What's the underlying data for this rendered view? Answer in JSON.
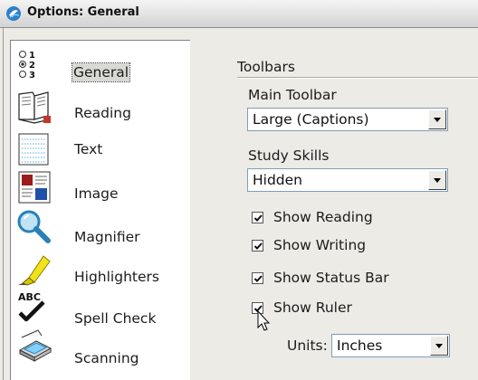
{
  "window": {
    "title": "Options: General"
  },
  "sidebar": {
    "items": [
      {
        "label": "General",
        "icon": "radio-list-icon",
        "selected": true
      },
      {
        "label": "Reading",
        "icon": "book-icon"
      },
      {
        "label": "Text",
        "icon": "text-page-icon"
      },
      {
        "label": "Image",
        "icon": "picture-icon"
      },
      {
        "label": "Magnifier",
        "icon": "magnifier-icon"
      },
      {
        "label": "Highlighters",
        "icon": "highlighter-icon"
      },
      {
        "label": "Spell Check",
        "icon": "spellcheck-icon"
      },
      {
        "label": "Scanning",
        "icon": "scanner-icon"
      }
    ]
  },
  "panel": {
    "section_title": "Toolbars",
    "main_toolbar": {
      "label": "Main Toolbar",
      "value": "Large (Captions)"
    },
    "study_skills": {
      "label": "Study Skills",
      "value": "Hidden"
    },
    "checkboxes": [
      {
        "label": "Show Reading",
        "checked": true
      },
      {
        "label": "Show Writing",
        "checked": true
      },
      {
        "label": "Show Status Bar",
        "checked": true
      },
      {
        "label": "Show Ruler",
        "checked": true
      }
    ],
    "units": {
      "label": "Units:",
      "value": "Inches"
    }
  },
  "icon_glyph_text": {
    "spellcheck": "ABC"
  },
  "colors": {
    "accent_red": "#c0392b",
    "check": "#111111"
  }
}
